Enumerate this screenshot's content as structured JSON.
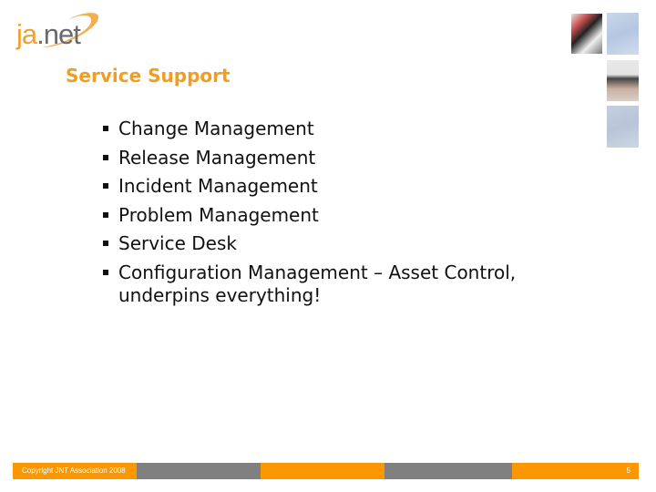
{
  "logo": {
    "part1": "ja",
    "part2": ".net",
    "colors": {
      "ja": "#f0a030",
      "net": "#6a6a6a",
      "swoosh": "#f0a030"
    }
  },
  "slide": {
    "title": "Service Support",
    "title_color": "#f39c1e",
    "bullets": [
      {
        "text": "Change Management"
      },
      {
        "text": "Release Management"
      },
      {
        "text": "Incident Management"
      },
      {
        "text": "Problem Management"
      },
      {
        "text": "Service Desk"
      },
      {
        "text": "Configuration Management – Asset Control,",
        "continuation": "underpins everything!"
      }
    ]
  },
  "decorative_photos": [
    "people-at-desk-photo",
    "blue-abstract-photo",
    "group-of-people-photo",
    "blue-abstract-photo-2"
  ],
  "footer": {
    "copyright": "Copyright JNT Association 2008",
    "page_number": "5",
    "colors": {
      "orange": "#fb9700",
      "gray": "#808080"
    }
  }
}
